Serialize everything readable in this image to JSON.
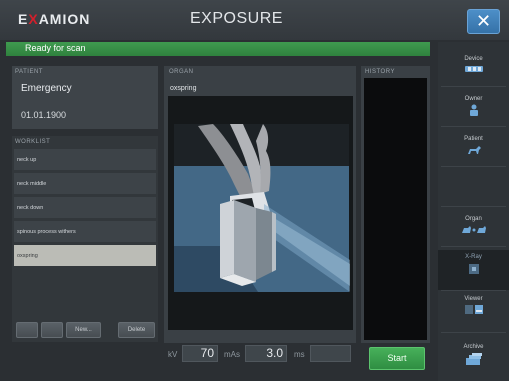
{
  "header": {
    "logo_prefix": "E",
    "logo_x": "X",
    "logo_suffix": "AMION",
    "title": "EXPOSURE",
    "close_label": "✕"
  },
  "status": {
    "text": "Ready for scan",
    "color": "#3a934a"
  },
  "patient": {
    "section_label": "PATIENT",
    "name": "Emergency",
    "dob": "01.01.1900"
  },
  "worklist": {
    "section_label": "WORKLIST",
    "items": [
      {
        "label": "neck up",
        "selected": false
      },
      {
        "label": "neck middle",
        "selected": false
      },
      {
        "label": "neck down",
        "selected": false
      },
      {
        "label": "spinous process withers",
        "selected": false
      },
      {
        "label": "oxspring",
        "selected": true
      }
    ],
    "new_label": "New...",
    "delete_label": "Delete"
  },
  "organ": {
    "section_label": "ORGAN",
    "value": "oxspring",
    "image_icon": "horse-hoof-xray-illustration"
  },
  "history": {
    "section_label": "HISTORY"
  },
  "parameters": {
    "kv_label": "kV",
    "kv_value": "70",
    "mas_label": "mAs",
    "mas_value": "3.0",
    "ms_label": "ms",
    "ms_value": ""
  },
  "actions": {
    "start_label": "Start",
    "start_color": "#3a9f4e"
  },
  "sidebar": {
    "items": [
      {
        "label": "Device",
        "icon": "device-icon",
        "active": false
      },
      {
        "label": "Owner",
        "icon": "owner-icon",
        "active": false
      },
      {
        "label": "Patient",
        "icon": "patient-dog-icon",
        "active": false
      },
      {
        "label": "Organ",
        "icon": "organ-icon",
        "active": false
      },
      {
        "label": "X-Ray",
        "icon": "xray-icon",
        "active": true
      },
      {
        "label": "Viewer",
        "icon": "viewer-icon",
        "active": false
      },
      {
        "label": "Archive",
        "icon": "archive-icon",
        "active": false
      }
    ]
  }
}
